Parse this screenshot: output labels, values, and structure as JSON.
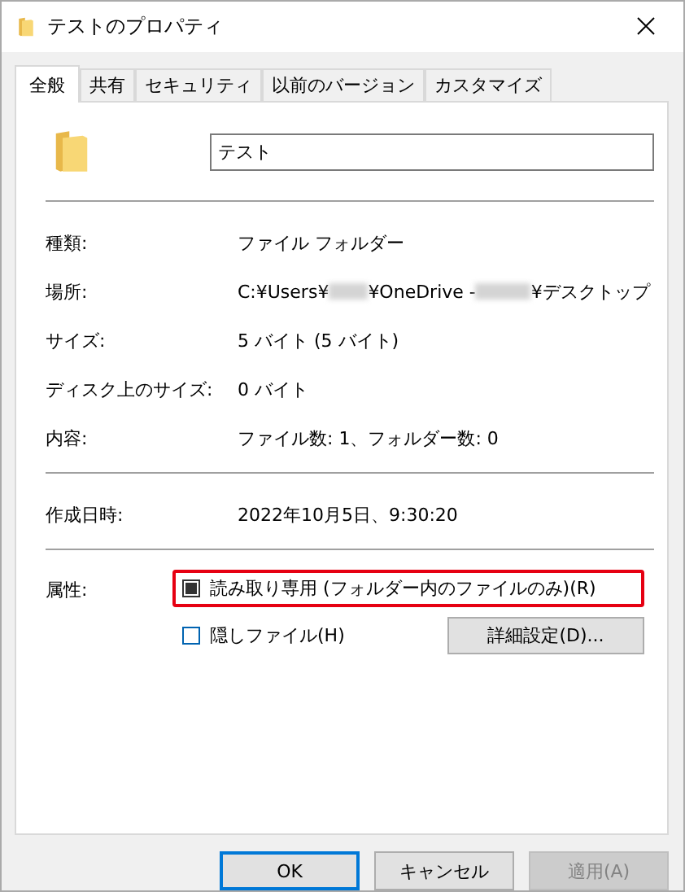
{
  "window": {
    "title": "テストのプロパティ"
  },
  "tabs": [
    {
      "label": "全般",
      "selected": true
    },
    {
      "label": "共有",
      "selected": false
    },
    {
      "label": "セキュリティ",
      "selected": false
    },
    {
      "label": "以前のバージョン",
      "selected": false
    },
    {
      "label": "カスタマイズ",
      "selected": false
    }
  ],
  "name_field": {
    "value": "テスト"
  },
  "properties": [
    {
      "label": "種類:",
      "segments": [
        {
          "kind": "text",
          "text": "ファイル フォルダー"
        }
      ]
    },
    {
      "label": "場所:",
      "segments": [
        {
          "kind": "text",
          "text": "C:¥Users¥"
        },
        {
          "kind": "redacted"
        },
        {
          "kind": "text",
          "text": "¥OneDrive - "
        },
        {
          "kind": "redacted"
        },
        {
          "kind": "text",
          "text": "¥デスクトップ"
        }
      ]
    },
    {
      "label": "サイズ:",
      "segments": [
        {
          "kind": "text",
          "text": "5 バイト (5 バイト)"
        }
      ]
    },
    {
      "label": "ディスク上のサイズ:",
      "segments": [
        {
          "kind": "text",
          "text": "0 バイト"
        }
      ]
    },
    {
      "label": "内容:",
      "segments": [
        {
          "kind": "text",
          "text": "ファイル数: 1、フォルダー数: 0"
        }
      ]
    }
  ],
  "created": {
    "label": "作成日時:",
    "value": "2022年10月5日、9:30:20"
  },
  "attributes": {
    "label": "属性:",
    "checkboxes": [
      {
        "label": "読み取り専用 (フォルダー内のファイルのみ)(R)",
        "checked": false,
        "indeterminate": true,
        "highlighted": true
      },
      {
        "label": "隠しファイル(H)",
        "checked": false,
        "indeterminate": false,
        "highlighted": false
      }
    ],
    "advanced_button": "詳細設定(D)..."
  },
  "buttons": [
    {
      "label": "OK",
      "default": true,
      "disabled": false
    },
    {
      "label": "キャンセル",
      "default": false,
      "disabled": false
    },
    {
      "label": "適用(A)",
      "default": false,
      "disabled": true
    }
  ]
}
